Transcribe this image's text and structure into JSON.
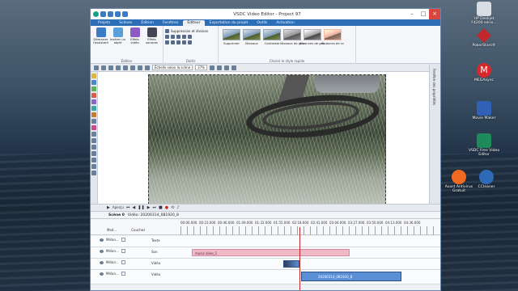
{
  "window": {
    "title": "VSDC Video Editor - Project 97"
  },
  "tabs": [
    "Projets",
    "Scènes",
    "Édition",
    "Fenêtres",
    "Éditeur",
    "Exportation du projet",
    "Outils",
    "Activation"
  ],
  "active_tab": "Éditeur",
  "ribbon": {
    "edit_group": {
      "label": "Édition",
      "buttons": [
        "Démarrer l'assistant",
        "Insérer un objet",
        "Effets vidéo",
        "Effets sonores"
      ]
    },
    "tools_group": {
      "label": "Outils",
      "items": [
        "Suppression et division"
      ]
    },
    "styles_group": {
      "label": "Choisir le style rapide",
      "styles": [
        "Supprimer",
        "Niveaux",
        "Contraste",
        "Niveaux de gris",
        "Nuances de gris",
        "Nuances de ro"
      ]
    }
  },
  "toolbar2": {
    "select_label": "Échelle selon la scène",
    "zoom": "37%"
  },
  "right_panel": {
    "label": "Fenêtre des propriétés"
  },
  "transport": {
    "apercu_label": "Aperçu"
  },
  "scene_bar": {
    "scene_label": "Scène 0",
    "breadcrumb": "Vidéo: 20200314_081920_8"
  },
  "timeline": {
    "layers_header": "Couches",
    "time_start": "00:00.000",
    "time_labels": [
      "00:00.000",
      "00:23.000",
      "00:46.000",
      "01:09.000",
      "01:32.000",
      "01:55.000",
      "02:18.000",
      "02:41.000",
      "03:04.000",
      "03:27.000",
      "03:50.000",
      "04:13.000",
      "04:36.000"
    ],
    "tracks": [
      {
        "blend": "Mélan...",
        "name": "Texte",
        "clip": ""
      },
      {
        "blend": "Mélan...",
        "name": "Son",
        "clip": "music alive_1"
      },
      {
        "blend": "Mélan...",
        "name": "Vidéo",
        "clip": ""
      },
      {
        "blend": "Mélan...",
        "name": "Vidéo",
        "clip": "20200314_081920_8"
      }
    ],
    "col_header": "Mod..."
  },
  "desktop_icons": [
    {
      "label": "HP Deskjet F4200 série...",
      "color": "#d8dde3"
    },
    {
      "label": "PokerStars®",
      "color": "#c0282d"
    },
    {
      "label": "MEGAsync",
      "color": "#d9272e"
    },
    {
      "label": "Movie Maker",
      "color": "#2f62b6"
    },
    {
      "label": "VSDC Free Video Editor",
      "color": "#1f8a5a"
    },
    {
      "label": "Avast Antivirus Gratuit",
      "color": "#f26a1f"
    },
    {
      "label": "CCleaner",
      "color": "#2d6bb7"
    }
  ],
  "colors": {
    "accent": "#2d6fb7",
    "audio_clip": "#f1b8c6",
    "video_clip": "#5a8fd6",
    "playhead": "#c62828"
  }
}
